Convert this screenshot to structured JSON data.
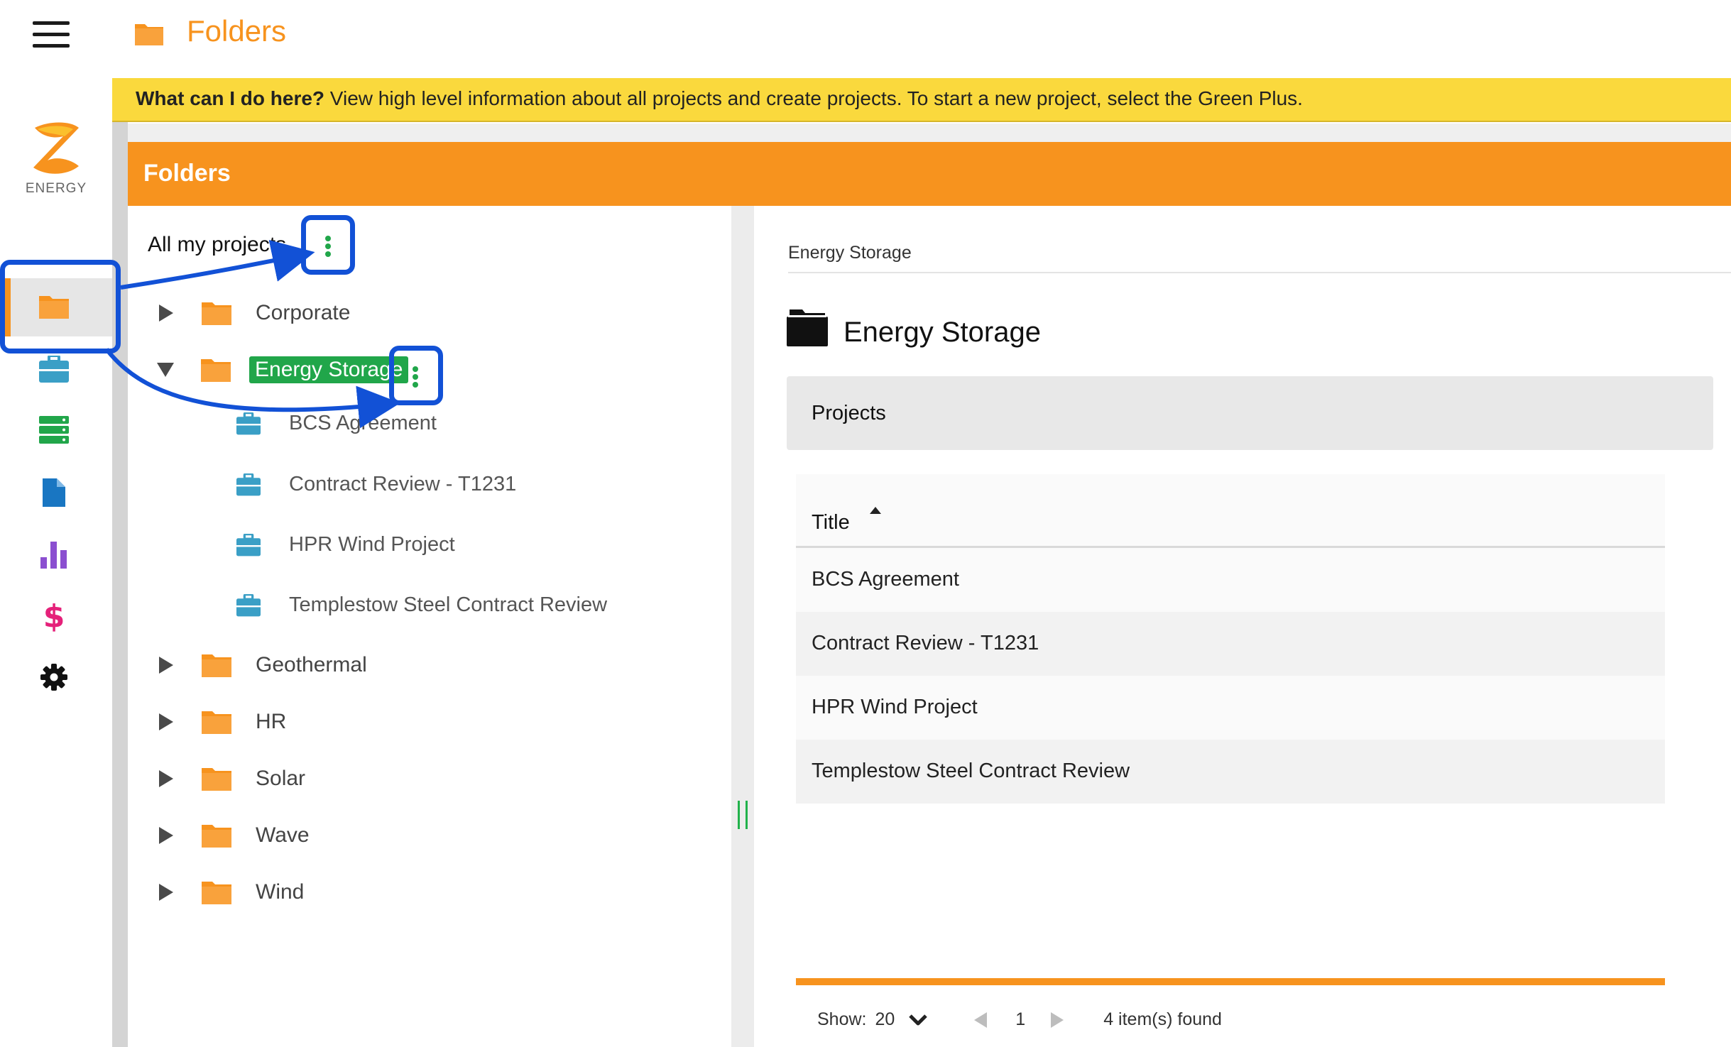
{
  "app": {
    "title": "Folders",
    "logo_text": "ENERGY"
  },
  "banner": {
    "question": "What can I do here?",
    "text": " View high level information about all projects and create projects. To start a new project, select the Green Plus."
  },
  "panel": {
    "title": "Folders"
  },
  "rail": {
    "icons": [
      "folder-icon",
      "briefcase-icon",
      "server-icon",
      "document-icon",
      "bar-chart-icon",
      "dollar-icon",
      "gear-icon"
    ],
    "active": "folder-icon"
  },
  "tree": {
    "root_label": "All my projects",
    "folders": [
      {
        "label": "Corporate",
        "expanded": false
      },
      {
        "label": "Energy Storage",
        "expanded": true,
        "selected": true,
        "projects": [
          "BCS Agreement",
          "Contract Review - T1231",
          "HPR Wind Project",
          "Templestow Steel Contract Review"
        ]
      },
      {
        "label": "Geothermal",
        "expanded": false
      },
      {
        "label": "HR",
        "expanded": false
      },
      {
        "label": "Solar",
        "expanded": false
      },
      {
        "label": "Wave",
        "expanded": false
      },
      {
        "label": "Wind",
        "expanded": false
      }
    ]
  },
  "detail": {
    "breadcrumb": "Energy Storage",
    "title": "Energy Storage",
    "section": "Projects",
    "column_title": "Title",
    "rows": [
      "BCS Agreement",
      "Contract Review - T1231",
      "HPR Wind Project",
      "Templestow Steel Contract Review"
    ]
  },
  "pager": {
    "show_label": "Show:",
    "page_size": "20",
    "page": "1",
    "found": "4 item(s) found"
  },
  "colors": {
    "brand_orange": "#f7931e",
    "banner_yellow": "#fad93d",
    "accent_green": "#21a64a",
    "annotation_blue": "#1251d6"
  }
}
